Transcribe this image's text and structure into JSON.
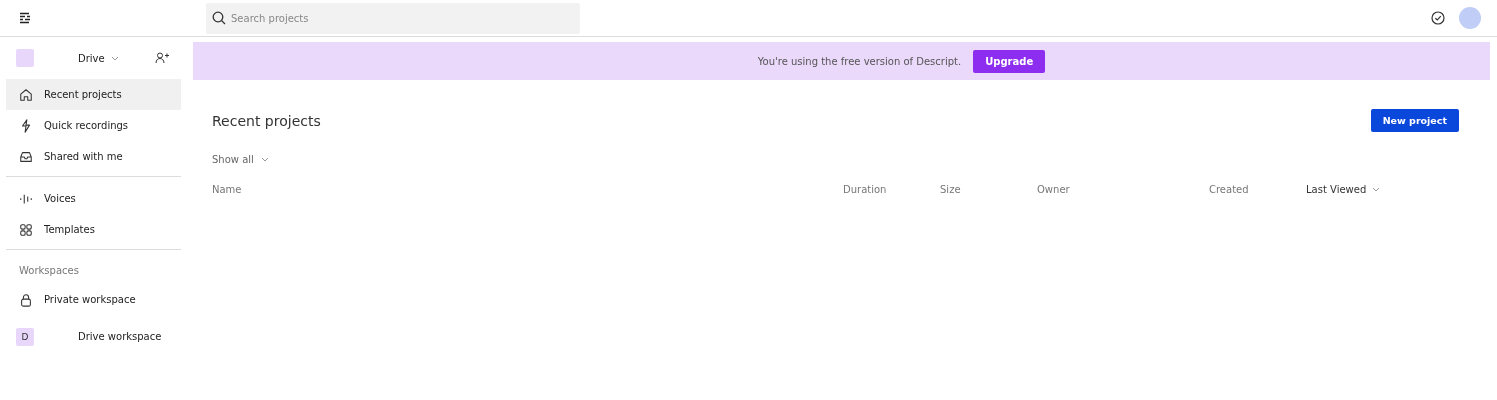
{
  "top_bar": {
    "search": {
      "placeholder": "Search projects"
    }
  },
  "sidebar": {
    "workspace_switcher": {
      "label": "Drive"
    },
    "groups": [
      {
        "items": [
          {
            "label": "Recent projects",
            "kind": "home",
            "selected": true
          },
          {
            "label": "Quick recordings",
            "kind": "bolt",
            "selected": false
          },
          {
            "label": "Shared with me",
            "kind": "inbox",
            "selected": false
          }
        ]
      },
      {
        "items": [
          {
            "label": "Voices",
            "kind": "voices",
            "selected": false
          },
          {
            "label": "Templates",
            "kind": "templates",
            "selected": false
          }
        ]
      }
    ],
    "workspaces": {
      "heading": "Workspaces",
      "items": [
        {
          "label": "Private workspace",
          "kind": "lock",
          "selected": false
        },
        {
          "label": "Drive workspace",
          "kind": "avatar",
          "initial": "D",
          "selected": false
        }
      ]
    }
  },
  "banner": {
    "text": "You're using the free version of Descript.",
    "button": "Upgrade"
  },
  "main": {
    "title": "Recent projects",
    "new_button": "New project",
    "filter": "Show all",
    "columns": [
      {
        "label": "Name",
        "sorted": false
      },
      {
        "label": "Duration",
        "sorted": false
      },
      {
        "label": "Size",
        "sorted": false
      },
      {
        "label": "Owner",
        "sorted": false
      },
      {
        "label": "Created",
        "sorted": false
      },
      {
        "label": "Last Viewed",
        "sorted": true
      }
    ]
  }
}
